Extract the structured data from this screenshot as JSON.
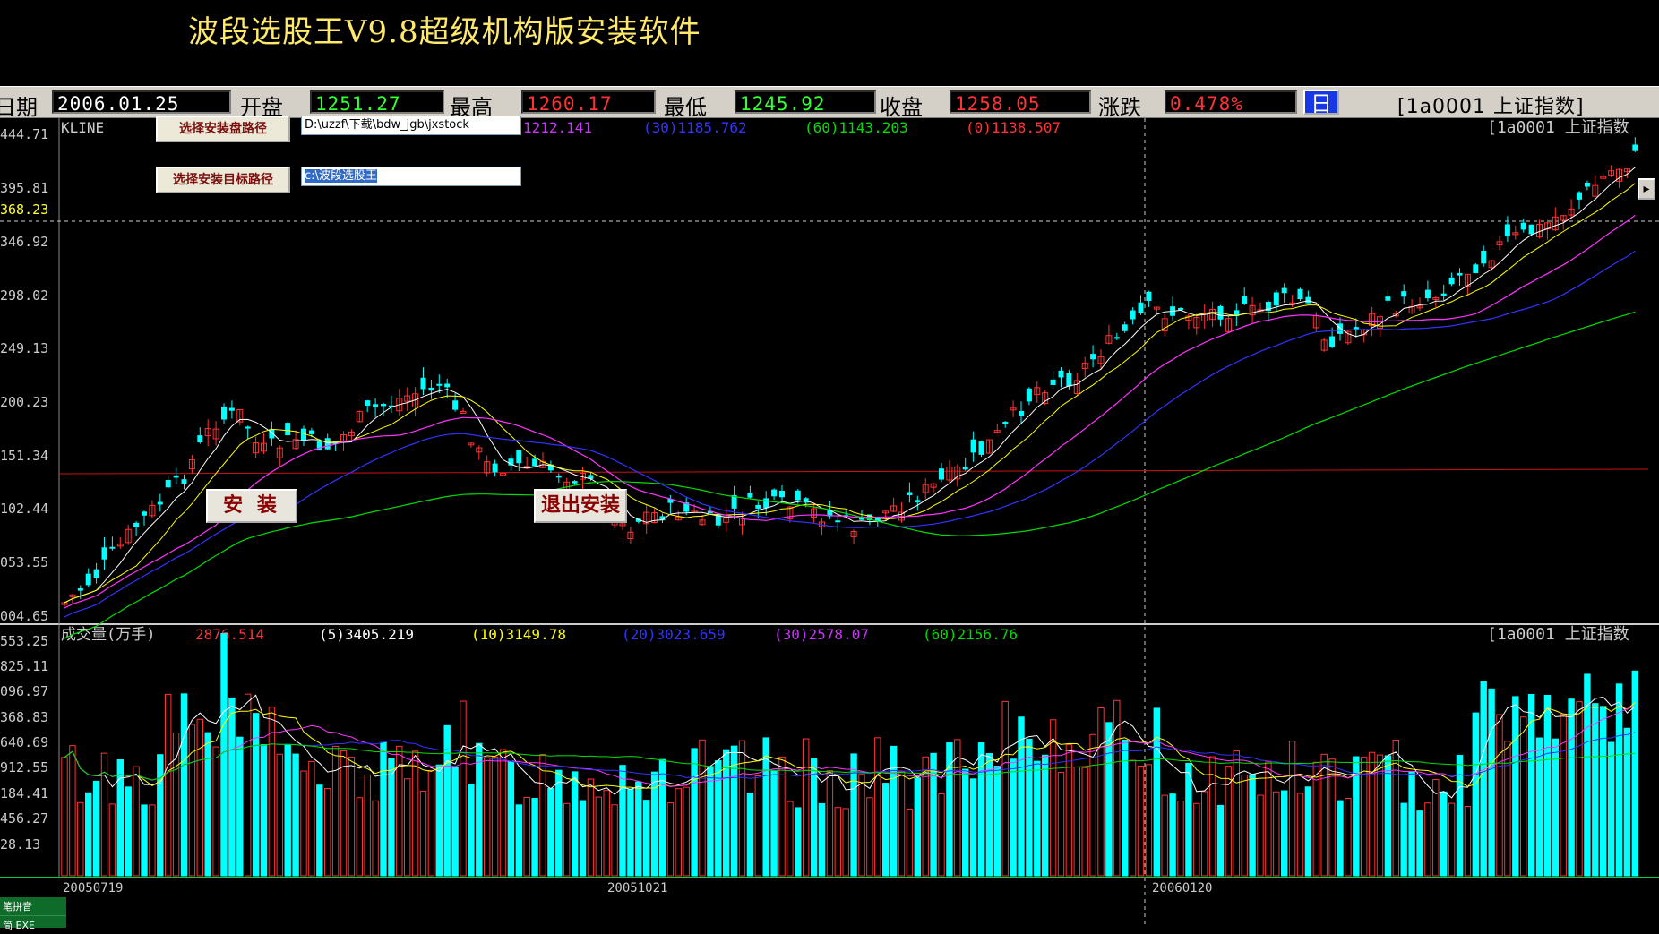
{
  "app_title": "波段选股王V9.8超级机构版安装软件",
  "infobar": {
    "date_label": "日期",
    "date_value": "2006.01.25",
    "open_label": "开盘",
    "open_value": "1251.27",
    "high_label": "最高",
    "high_value": "1260.17",
    "low_label": "最低",
    "low_value": "1245.92",
    "close_label": "收盘",
    "close_value": "1258.05",
    "change_label": "涨跌",
    "change_value": "0.478%",
    "calendar_glyph": "日",
    "index_label": "[1a0001 上证指数]"
  },
  "installer": {
    "select_source_label": "选择安装盘路径",
    "source_path": "D:\\uzzf\\下载\\bdw_jgb\\jxstock",
    "select_target_label": "选择安装目标路径",
    "target_path": "c:\\波段选股王",
    "install_label": "安  装",
    "exit_label": "退出安装"
  },
  "price_panel": {
    "title": "KLINE",
    "ma_readouts": [
      {
        "text": "1212.141",
        "color": "#cc33ff"
      },
      {
        "text": "(30)1185.762",
        "color": "#3333ff"
      },
      {
        "text": "(60)1143.203",
        "color": "#00dd00"
      },
      {
        "text": "(0)1138.507",
        "color": "#ff3333"
      }
    ],
    "index_tag": "[1a0001 上证指数",
    "y_labels": [
      "444.71",
      "395.81",
      "368.23",
      "346.92",
      "298.02",
      "249.13",
      "200.23",
      "151.34",
      "102.44",
      "053.55",
      "004.65"
    ]
  },
  "volume_panel": {
    "title": "成交量(万手)",
    "readouts": [
      {
        "text": "2876.514",
        "color": "#ff3333"
      },
      {
        "text": "(5)3405.219",
        "color": "#ffffff"
      },
      {
        "text": "(10)3149.78",
        "color": "#ffff00"
      },
      {
        "text": "(20)3023.659",
        "color": "#3333ff"
      },
      {
        "text": "(30)2578.07",
        "color": "#cc33ff"
      },
      {
        "text": "(60)2156.76",
        "color": "#00dd00"
      }
    ],
    "index_tag": "[1a0001 上证指数",
    "y_labels": [
      "553.25",
      "825.11",
      "096.97",
      "368.83",
      "640.69",
      "912.55",
      "184.41",
      "456.27",
      "28.13"
    ]
  },
  "date_axis": [
    "20050719",
    "20051021",
    "20060120"
  ],
  "ime": {
    "line1": "笔拼音",
    "line2": "简 EXE"
  },
  "colors": {
    "up": "#ff3333",
    "down": "#00ffff",
    "ma5": "#ffffff",
    "ma10": "#ffff00",
    "ma20": "#ff33ff",
    "ma30": "#3333ff",
    "ma60": "#00dd00"
  }
}
